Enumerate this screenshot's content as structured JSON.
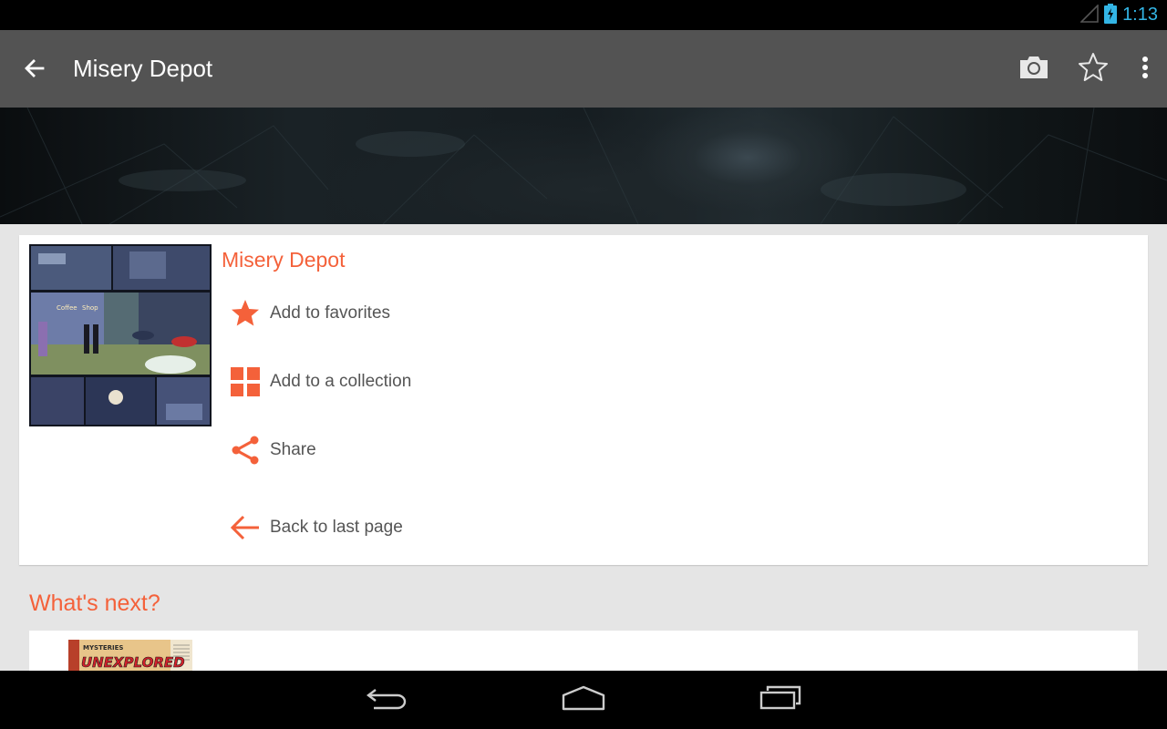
{
  "status_bar": {
    "time": "1:13",
    "icons": [
      "signal-icon",
      "battery-charging-icon"
    ]
  },
  "app_bar": {
    "title": "Misery Depot",
    "back_icon": "arrow-back-icon",
    "actions": [
      "camera-icon",
      "star-outline-icon",
      "overflow-menu-icon"
    ]
  },
  "detail_card": {
    "comic_title": "Misery Depot",
    "cover_image": "comic-page-thumbnail",
    "menu": [
      {
        "label": "Add to favorites",
        "icon": "star-icon"
      },
      {
        "label": "Add to a collection",
        "icon": "grid-icon"
      },
      {
        "label": "Share",
        "icon": "share-icon"
      },
      {
        "label": "Back to last page",
        "icon": "arrow-left-icon"
      }
    ]
  },
  "whats_next": {
    "title": "What's next?",
    "items": [
      {
        "cover_text": "MYSTERIES OF UNEXPLORED"
      }
    ]
  },
  "nav_bar": {
    "buttons": [
      "back-nav-icon",
      "home-nav-icon",
      "recents-nav-icon"
    ]
  },
  "colors": {
    "accent": "#f4613a",
    "app_bar": "#535353",
    "status_time": "#33b5e5",
    "background": "#e5e5e5"
  }
}
